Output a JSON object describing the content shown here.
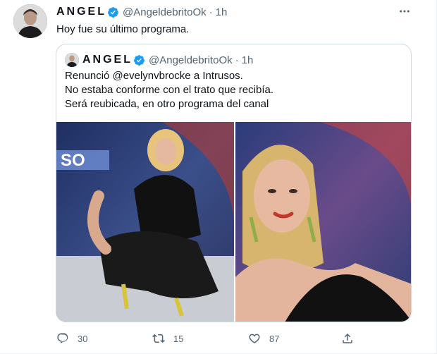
{
  "author": {
    "name": "ANGEL",
    "handle": "@AngeldebritoOk",
    "separator": "·",
    "time": "1h"
  },
  "tweet_text": "Hoy fue su último programa.",
  "more_icon": "more-horizontal-icon",
  "quoted": {
    "name": "ANGEL",
    "handle": "@AngeldebritoOk",
    "separator": "·",
    "time": "1h",
    "lines": [
      "Renunció @evelynvbrocke a Intrusos.",
      "No estaba conforme con el trato que recibía.",
      "Será reubicada, en otro programa del canal"
    ]
  },
  "actions": {
    "reply_count": "30",
    "retweet_count": "15",
    "like_count": "87"
  },
  "colors": {
    "verified": "#1d9bf0",
    "secondary_text": "#536471",
    "border": "#cfd9de"
  }
}
